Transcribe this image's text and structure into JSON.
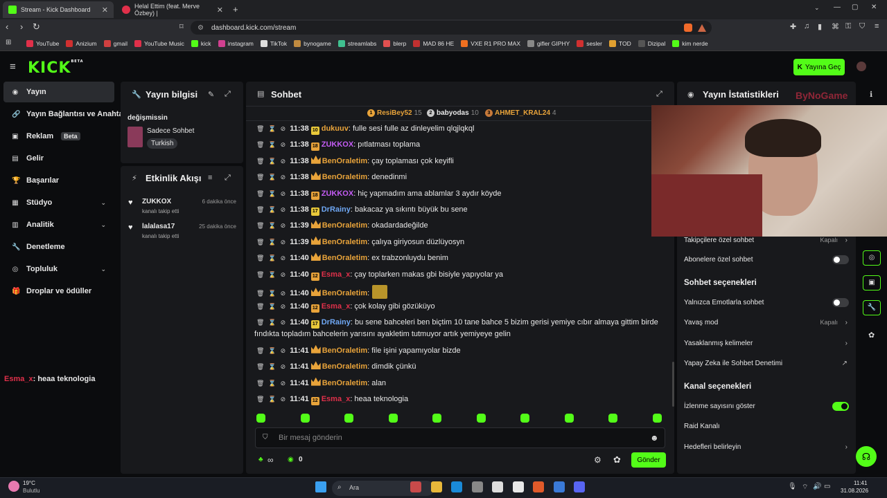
{
  "browser": {
    "tabs": [
      {
        "title": "Stream - Kick Dashboard"
      },
      {
        "title": "Helal Ettim (feat. Merve Özbey) |"
      }
    ],
    "url": "dashboard.kick.com/stream",
    "bookmarks": [
      "YouTube",
      "Anizium",
      "gmail",
      "YouTube Music",
      "kick",
      "instagram",
      "TikTok",
      "bynogame",
      "streamlabs",
      "blerp",
      "MAD 86 HE",
      "VXE R1 PRO MAX",
      "gifler GIPHY",
      "sesler",
      "TOD",
      "Dizipal",
      "kim nerde"
    ]
  },
  "header": {
    "logo": "KICK",
    "logo_sup": "BETA",
    "go_live": "Yayına Geç"
  },
  "sidebar": {
    "items": [
      {
        "label": "Yayın",
        "icon": "broadcast-icon",
        "active": true
      },
      {
        "label": "Yayın Bağlantısı ve Anahtar",
        "icon": "link-icon"
      },
      {
        "label": "Reklam",
        "icon": "ad-icon",
        "badge": "Beta"
      },
      {
        "label": "Gelir",
        "icon": "money-icon"
      },
      {
        "label": "Başarılar",
        "icon": "trophy-icon"
      },
      {
        "label": "Stüdyo",
        "icon": "studio-icon",
        "chevron": true
      },
      {
        "label": "Analitik",
        "icon": "analytics-icon",
        "chevron": true
      },
      {
        "label": "Denetleme",
        "icon": "wrench-icon"
      },
      {
        "label": "Topluluk",
        "icon": "community-icon",
        "chevron": true
      },
      {
        "label": "Droplar ve ödüller",
        "icon": "gift-icon"
      }
    ]
  },
  "stream_info": {
    "title": "Yayın bilgisi",
    "stream_title": "değişmissin",
    "category": "Sadece Sohbet",
    "tag": "Turkish"
  },
  "activity": {
    "title": "Etkinlik Akışı",
    "events": [
      {
        "user": "ZUKKOX",
        "action": "kanalı takip etti",
        "time": "6 dakika önce"
      },
      {
        "user": "lalalasa17",
        "action": "kanalı takip etti",
        "time": "25 dakika önce"
      }
    ]
  },
  "overlay": {
    "user": "Esma_x",
    "text": ": heaa teknologia"
  },
  "chat": {
    "title": "Sohbet",
    "leaders": [
      {
        "rank": "1",
        "name": "ResiBey52",
        "count": "15"
      },
      {
        "rank": "2",
        "name": "babyodas",
        "count": "10"
      },
      {
        "rank": "3",
        "name": "AHMET_KRAL24",
        "count": "4"
      }
    ],
    "messages": [
      {
        "time": "11:38",
        "badge": "10",
        "user": "dukuuv",
        "color": "#e8a33a",
        "text": ": fulle sesi fulle az dinleyelim qlqjlqkql"
      },
      {
        "time": "11:38",
        "badge": "18",
        "user": "ZUKKOX",
        "color": "#c45cf5",
        "text": ": pıtlatması toplama"
      },
      {
        "time": "11:38",
        "crown": true,
        "user": "BenOraletim",
        "color": "#e8a33a",
        "text": ": çay toplaması çok keyifli"
      },
      {
        "time": "11:38",
        "crown": true,
        "user": "BenOraletim",
        "color": "#e8a33a",
        "text": ": denedinmi"
      },
      {
        "time": "11:38",
        "badge": "18",
        "user": "ZUKKOX",
        "color": "#c45cf5",
        "text": ": hiç yapmadım ama ablamlar 3 aydır köyde"
      },
      {
        "time": "11:38",
        "badge": "17",
        "user": "DrRainy",
        "color": "#6fa8f5",
        "text": ": bakacaz ya sıkıntı büyük bu sene"
      },
      {
        "time": "11:39",
        "crown": true,
        "user": "BenOraletim",
        "color": "#e8a33a",
        "text": ": okadardadeğilde"
      },
      {
        "time": "11:39",
        "crown": true,
        "user": "BenOraletim",
        "color": "#e8a33a",
        "text": ": çalıya giriyosun düzlüyosyn"
      },
      {
        "time": "11:40",
        "crown": true,
        "user": "BenOraletim",
        "color": "#e8a33a",
        "text": ": ex trabzonluydu benim"
      },
      {
        "time": "11:40",
        "badge": "12",
        "user": "Esma_x",
        "color": "#e0304a",
        "text": ": çay toplarken makas gbi bisiyle yapıyolar ya"
      },
      {
        "time": "11:40",
        "crown": true,
        "user": "BenOraletim",
        "color": "#e8a33a",
        "text": ":",
        "emote": true
      },
      {
        "time": "11:40",
        "badge": "12",
        "user": "Esma_x",
        "color": "#e0304a",
        "text": ": çok kolay gibi gözüküyo"
      },
      {
        "time": "11:40",
        "badge": "17",
        "user": "DrRainy",
        "color": "#6fa8f5",
        "text": ": bu sene bahceleri ben biçtim 10 tane bahce 5 bizim gerisi yemiye cıbır almaya gittim birde",
        "text2": "fındıkta topladım bahcelerin yarısını ayakletim tutmuyor artık yemiyeye gelin"
      },
      {
        "time": "11:41",
        "crown": true,
        "user": "BenOraletim",
        "color": "#e8a33a",
        "text": ": file işini yapamıyolar bizde"
      },
      {
        "time": "11:41",
        "crown": true,
        "user": "BenOraletim",
        "color": "#e8a33a",
        "text": ": dimdik çünkü"
      },
      {
        "time": "11:41",
        "crown": true,
        "user": "BenOraletim",
        "color": "#e8a33a",
        "text": ": alan"
      },
      {
        "time": "11:41",
        "badge": "12",
        "user": "Esma_x",
        "color": "#e0304a",
        "text": ": heaa teknologia"
      }
    ],
    "input_placeholder": "Bir mesaj gönderin",
    "points": "∞",
    "coins": "0",
    "send": "Gönder"
  },
  "stats": {
    "title": "Yayın İstatistikleri",
    "rows": [
      {
        "label": "Takipçilere özel sohbet",
        "value": "Kapalı",
        "kind": "chevron"
      },
      {
        "label": "Abonelere özel sohbet",
        "kind": "toggle",
        "on": false
      }
    ],
    "section1": "Sohbet seçenekleri",
    "rows2": [
      {
        "label": "Yalnızca Emotlarla sohbet",
        "kind": "toggle",
        "on": false
      },
      {
        "label": "Yavaş mod",
        "value": "Kapalı",
        "kind": "chevron"
      },
      {
        "label": "Yasaklanmış kelimeler",
        "kind": "chevron"
      },
      {
        "label": "Yapay Zeka ile Sohbet Denetimi",
        "kind": "external"
      }
    ],
    "section2": "Kanal seçenekleri",
    "rows3": [
      {
        "label": "İzlenme sayısını göster",
        "kind": "toggle",
        "on": true
      },
      {
        "label": "Raid Kanalı",
        "kind": "none"
      },
      {
        "label": "Hedefleri belirleyin",
        "kind": "chevron"
      }
    ],
    "webcam_logo": "ByNoGame"
  },
  "taskbar": {
    "weather_temp": "19°C",
    "weather_desc": "Bulutlu",
    "search": "Ara",
    "time": "11:41",
    "date": "31.08.2026"
  }
}
